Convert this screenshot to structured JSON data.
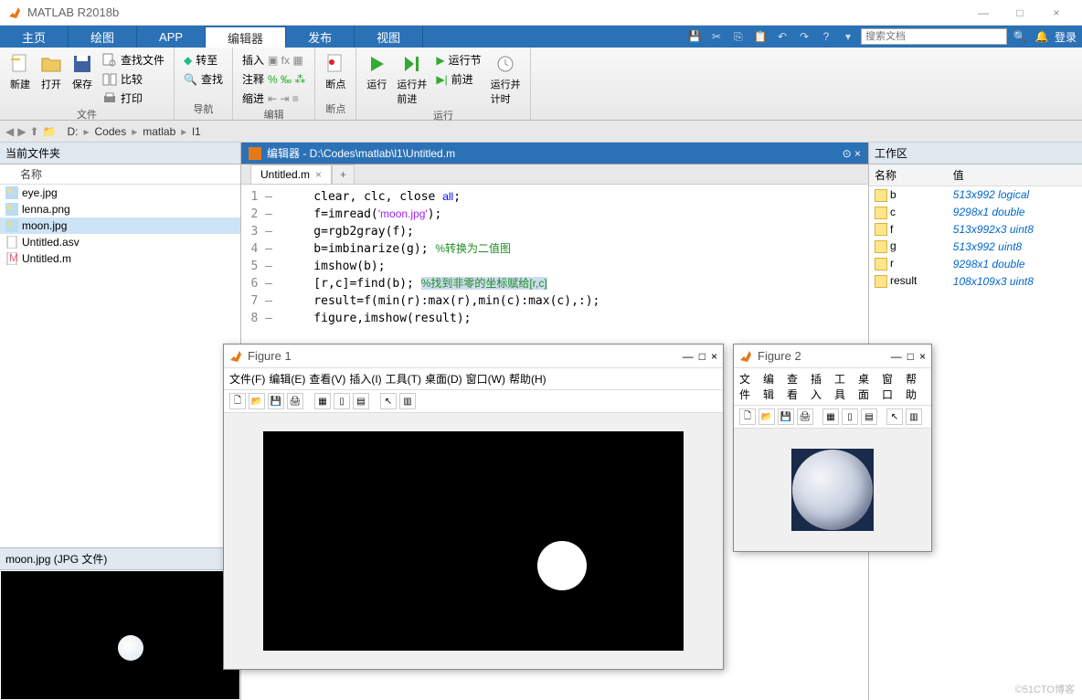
{
  "window": {
    "title": "MATLAB R2018b",
    "min": "—",
    "max": "□",
    "close": "×"
  },
  "tabs": [
    "主页",
    "绘图",
    "APP",
    "编辑器",
    "发布",
    "视图"
  ],
  "activeTab": 3,
  "search_placeholder": "搜索文档",
  "login": "登录",
  "ribbon": {
    "file": {
      "new": "新建",
      "open": "打开",
      "save": "保存",
      "findFiles": "查找文件",
      "compare": "比较",
      "print": "打印",
      "group": "文件"
    },
    "nav": {
      "goto": "转至",
      "find": "查找",
      "group": "导航"
    },
    "edit": {
      "insert": "插入",
      "comment": "注释",
      "indent": "缩进",
      "group": "编辑"
    },
    "break": {
      "breakpoint": "断点",
      "group": "断点"
    },
    "run": {
      "run": "运行",
      "runAdvance": "运行并\n前进",
      "runSection": "运行节",
      "advance": "前进",
      "runTime": "运行并\n计时",
      "group": "运行"
    }
  },
  "breadcrumb": [
    "D:",
    "Codes",
    "matlab",
    "l1"
  ],
  "folder": {
    "header": "当前文件夹",
    "col": "名称",
    "files": [
      {
        "name": "eye.jpg",
        "icon": "img"
      },
      {
        "name": "lenna.png",
        "icon": "img"
      },
      {
        "name": "moon.jpg",
        "icon": "img",
        "selected": true
      },
      {
        "name": "Untitled.asv",
        "icon": "doc"
      },
      {
        "name": "Untitled.m",
        "icon": "m"
      }
    ],
    "preview": "moon.jpg  (JPG 文件)"
  },
  "editor": {
    "title": "编辑器 - D:\\Codes\\matlab\\l1\\Untitled.m",
    "tab": "Untitled.m",
    "lines": [
      {
        "n": "1",
        "pre": "clear, clc, close ",
        "kw": "all",
        "post": ";"
      },
      {
        "n": "2",
        "pre": "f=imread(",
        "str": "'moon.jpg'",
        "post": ");"
      },
      {
        "n": "3",
        "pre": "g=rgb2gray(f);"
      },
      {
        "n": "4",
        "pre": "b=imbinarize(g); ",
        "cm": "%转换为二值图"
      },
      {
        "n": "5",
        "pre": "imshow(b);"
      },
      {
        "n": "6",
        "pre": "[r,c]=find(b); ",
        "sel": "%找到非零的坐标赋给[r,c]"
      },
      {
        "n": "7",
        "pre": "result=f(min(r):max(r),min(c):max(c),:);"
      },
      {
        "n": "8",
        "pre": "figure,imshow(result);"
      }
    ]
  },
  "workspace": {
    "header": "工作区",
    "cols": [
      "名称",
      "值"
    ],
    "vars": [
      {
        "name": "b",
        "val": "513x992 logical"
      },
      {
        "name": "c",
        "val": "9298x1 double"
      },
      {
        "name": "f",
        "val": "513x992x3 uint8"
      },
      {
        "name": "g",
        "val": "513x992 uint8"
      },
      {
        "name": "r",
        "val": "9298x1 double"
      },
      {
        "name": "result",
        "val": "108x109x3 uint8"
      }
    ]
  },
  "figure1": {
    "title": "Figure 1",
    "menu": [
      "文件(F)",
      "编辑(E)",
      "查看(V)",
      "插入(I)",
      "工具(T)",
      "桌面(D)",
      "窗口(W)",
      "帮助(H)"
    ]
  },
  "figure2": {
    "title": "Figure 2",
    "menu": [
      "文件",
      "编辑",
      "查看",
      "插入",
      "工具",
      "桌面",
      "窗口",
      "帮助"
    ]
  },
  "watermark": "©51CTO博客"
}
